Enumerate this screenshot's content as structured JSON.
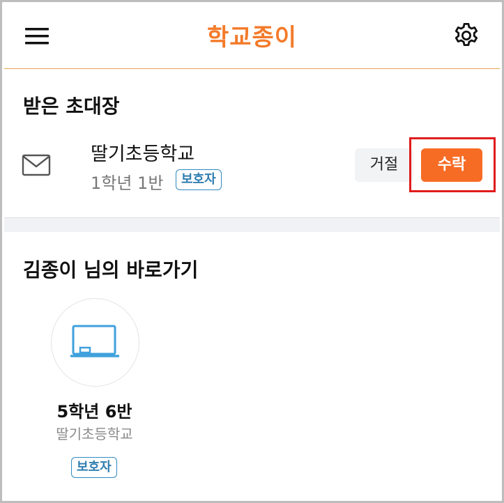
{
  "header": {
    "app_title": "학교종이",
    "menu_icon": "hamburger-menu-icon",
    "settings_icon": "gear-icon"
  },
  "invitations": {
    "title": "받은 초대장",
    "items": [
      {
        "icon": "mail-icon",
        "school": "딸기초등학교",
        "class_name": "1학년 1반",
        "role": "보호자",
        "reject_label": "거절",
        "accept_label": "수락"
      }
    ]
  },
  "shortcuts": {
    "title": "김종이 님의 바로가기",
    "items": [
      {
        "icon": "blackboard-icon",
        "class_name": "5학년 6반",
        "school": "딸기초등학교",
        "role": "보호자"
      }
    ]
  },
  "colors": {
    "brand": "#f47a2a",
    "accept_button": "#f76c25",
    "badge": "#2f8ac2",
    "highlight": "#e01b1b"
  }
}
